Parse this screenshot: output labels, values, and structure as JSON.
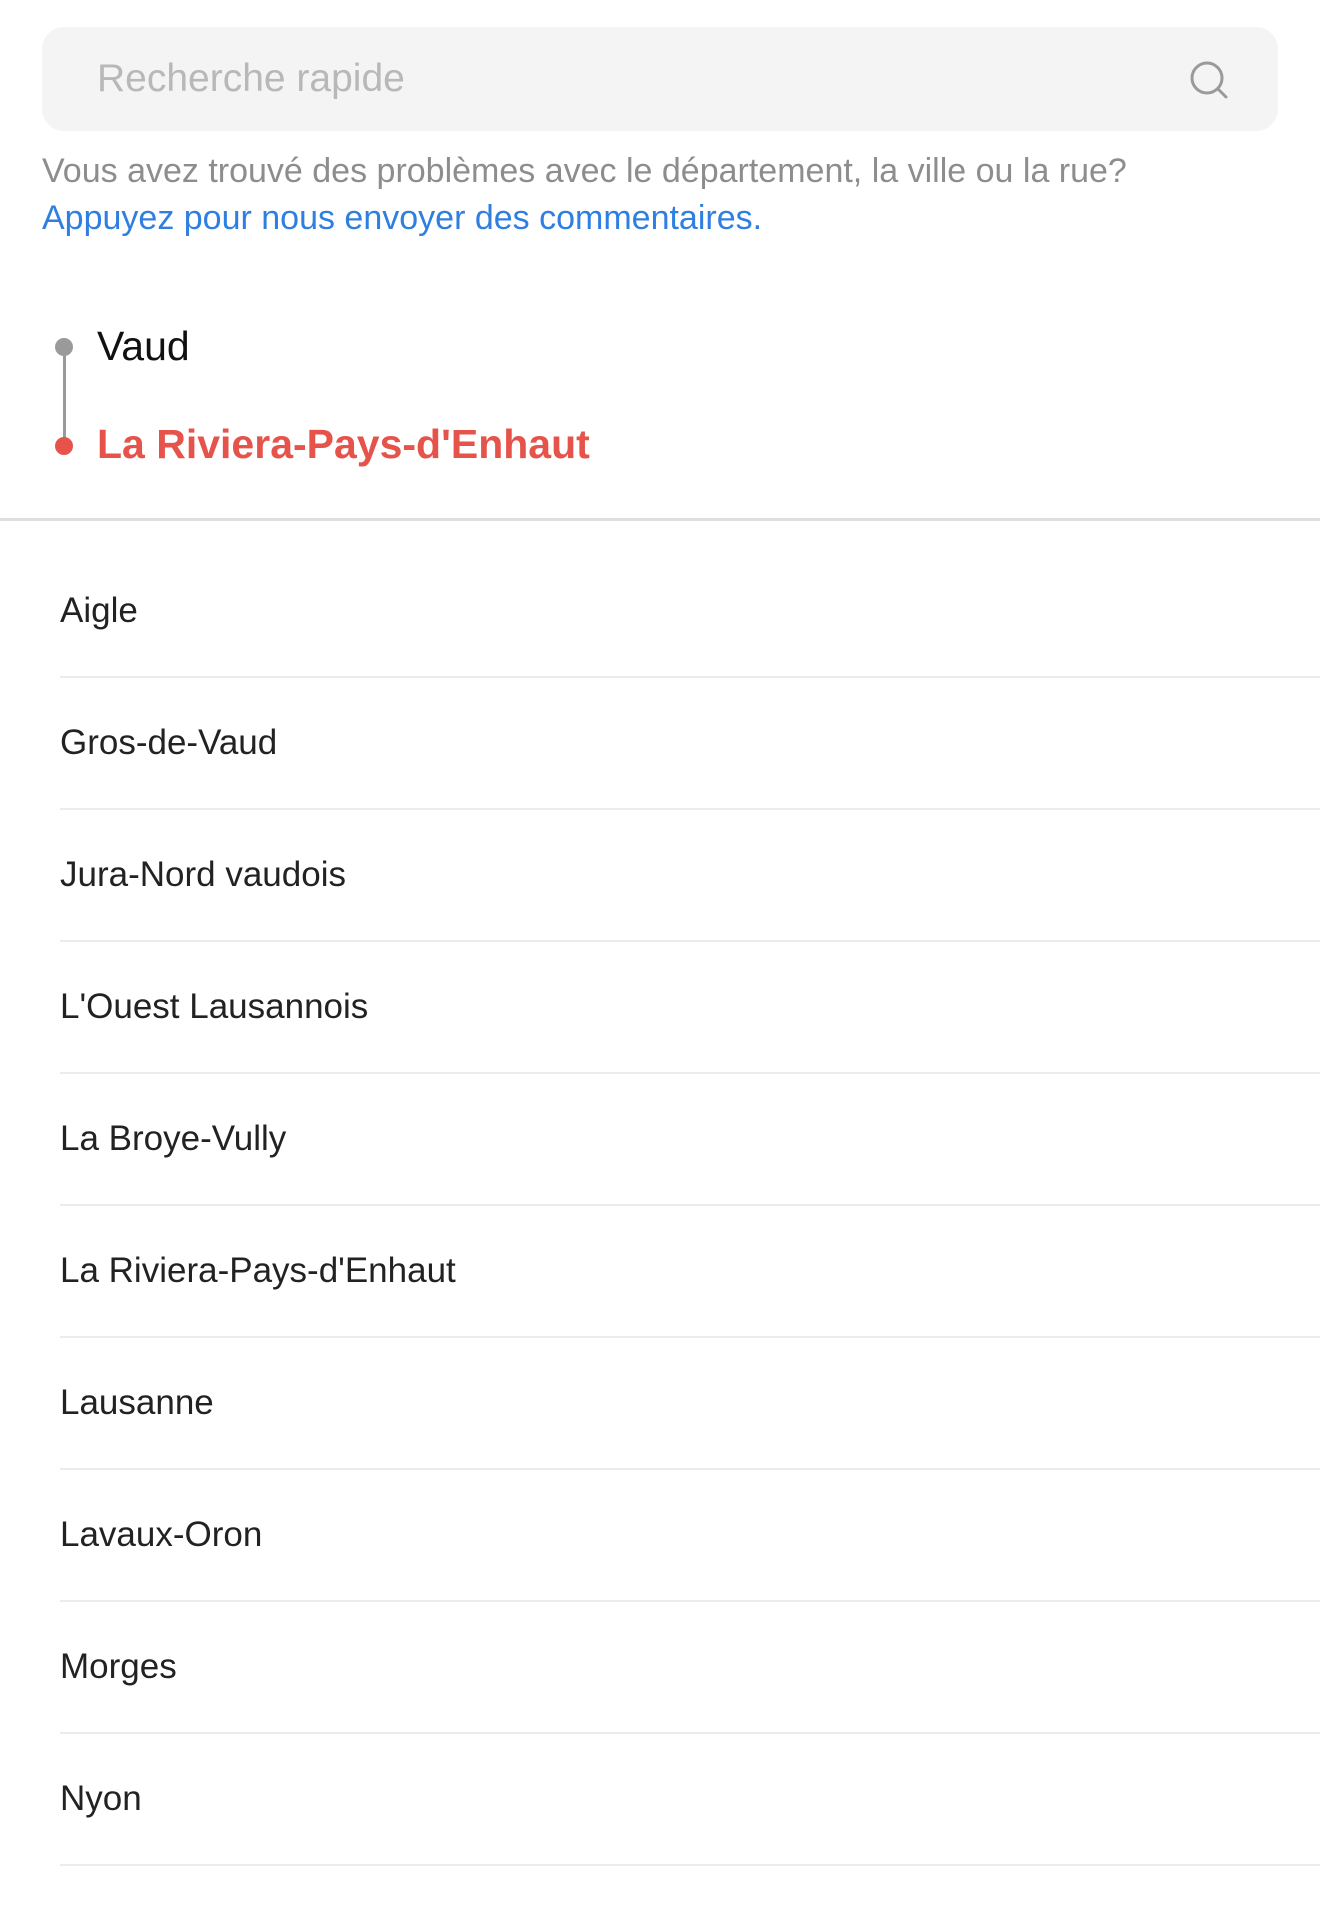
{
  "search": {
    "placeholder": "Recherche rapide",
    "value": "",
    "icon": "search-icon"
  },
  "notice": {
    "text": "Vous avez trouvé des problèmes avec le département, la ville ou la rue?",
    "link_text": "Appuyez pour nous envoyer des commentaires."
  },
  "breadcrumb": {
    "items": [
      {
        "label": "Vaud"
      },
      {
        "label": "La Riviera-Pays-d'Enhaut"
      }
    ]
  },
  "districts": [
    "Aigle",
    "Gros-de-Vaud",
    "Jura-Nord vaudois",
    "L'Ouest Lausannois",
    "La Broye-Vully",
    "La Riviera-Pays-d'Enhaut",
    "Lausanne",
    "Lavaux-Oron",
    "Morges",
    "Nyon"
  ],
  "colors": {
    "accent_red": "#e5534b",
    "link_blue": "#2f7fe0",
    "muted_grey": "#8d8d8d",
    "search_bg": "#f4f4f4"
  }
}
